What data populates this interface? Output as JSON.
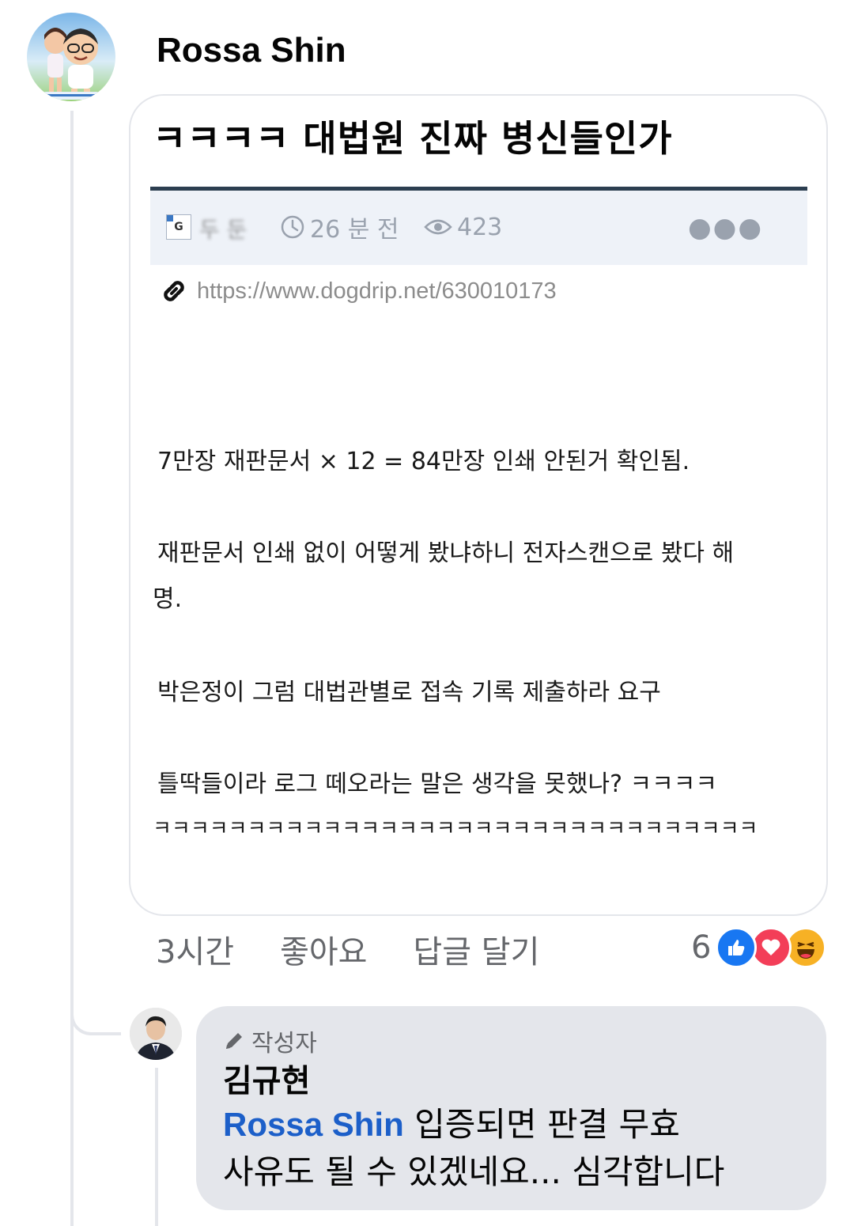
{
  "comment": {
    "author": "Rossa Shin",
    "avatar_icon": "profile-avatar",
    "post": {
      "title": "ㅋㅋㅋㅋ 대법원 진짜 병신들인가",
      "site_badge": "G",
      "username_blurred": "두 둔",
      "time": "26 분 전",
      "views": "423",
      "more_icon": "more-dots-icon",
      "link": "https://www.dogdrip.net/630010173",
      "paragraphs": [
        "7만장 재판문서 × 12 = 84만장 인쇄 안된거 확인됨.",
        "재판문서 인쇄 없이 어떻게 봤냐하니 전자스캔으로 봤다 해",
        "명.",
        "박은정이 그럼 대법관별로 접속 기록 제출하라 요구",
        "틀딱들이라 로그 떼오라는 말은 생각을 못했나? ㅋㅋㅋㅋ",
        "ㅋㅋㅋㅋㅋㅋㅋㅋㅋㅋㅋㅋㅋㅋㅋㅋㅋㅋㅋㅋㅋㅋㅋㅋㅋㅋㅋㅋㅋㅋㅋㅋ"
      ]
    },
    "actions": {
      "time_ago": "3시간",
      "like": "좋아요",
      "reply": "답글 달기"
    },
    "reactions": {
      "count": "6",
      "icons": [
        "like-icon",
        "love-icon",
        "haha-icon"
      ],
      "colors": {
        "like": "#1877f2",
        "love": "#f33e58",
        "haha": "#f7b125"
      }
    }
  },
  "reply": {
    "badge": "작성자",
    "badge_icon": "pencil-icon",
    "author": "김규현",
    "mention": "Rossa Shin",
    "text_line1": " 입증되면 판결 무효",
    "text_line2": "사유도 될 수 있겠네요... 심각합니다"
  }
}
